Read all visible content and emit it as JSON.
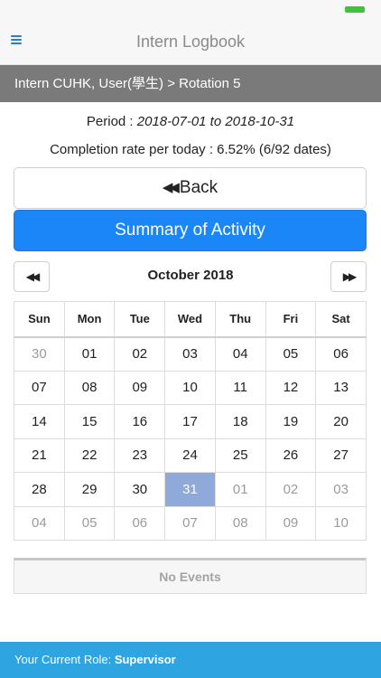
{
  "header": {
    "title": "Intern Logbook"
  },
  "breadcrumb": {
    "text": "Intern CUHK, User(學生) > Rotation 5"
  },
  "period": {
    "label": "Period : ",
    "value": "2018-07-01 to 2018-10-31"
  },
  "completion": {
    "text": "Completion rate per today : 6.52% (6/92 dates)"
  },
  "buttons": {
    "back": "Back",
    "summary": "Summary of Activity"
  },
  "calendar": {
    "month": "October 2018",
    "weekdays": [
      "Sun",
      "Mon",
      "Tue",
      "Wed",
      "Thu",
      "Fri",
      "Sat"
    ],
    "weeks": [
      [
        {
          "d": "30",
          "m": true
        },
        {
          "d": "01"
        },
        {
          "d": "02"
        },
        {
          "d": "03"
        },
        {
          "d": "04"
        },
        {
          "d": "05"
        },
        {
          "d": "06"
        }
      ],
      [
        {
          "d": "07"
        },
        {
          "d": "08"
        },
        {
          "d": "09"
        },
        {
          "d": "10"
        },
        {
          "d": "11"
        },
        {
          "d": "12"
        },
        {
          "d": "13"
        }
      ],
      [
        {
          "d": "14"
        },
        {
          "d": "15"
        },
        {
          "d": "16"
        },
        {
          "d": "17"
        },
        {
          "d": "18"
        },
        {
          "d": "19"
        },
        {
          "d": "20"
        }
      ],
      [
        {
          "d": "21"
        },
        {
          "d": "22"
        },
        {
          "d": "23"
        },
        {
          "d": "24"
        },
        {
          "d": "25"
        },
        {
          "d": "26"
        },
        {
          "d": "27"
        }
      ],
      [
        {
          "d": "28"
        },
        {
          "d": "29"
        },
        {
          "d": "30"
        },
        {
          "d": "31",
          "today": true
        },
        {
          "d": "01",
          "m": true
        },
        {
          "d": "02",
          "m": true
        },
        {
          "d": "03",
          "m": true
        }
      ],
      [
        {
          "d": "04",
          "m": true
        },
        {
          "d": "05",
          "m": true
        },
        {
          "d": "06",
          "m": true
        },
        {
          "d": "07",
          "m": true
        },
        {
          "d": "08",
          "m": true
        },
        {
          "d": "09",
          "m": true
        },
        {
          "d": "10",
          "m": true
        }
      ]
    ]
  },
  "events": {
    "empty_text": "No Events"
  },
  "footer": {
    "role_label": "Your Current Role: ",
    "role_value": "Supervisor"
  },
  "colors": {
    "primary": "#1a86f7",
    "today": "#8fa9d9",
    "footer": "#2ea4e0",
    "breadcrumb": "#7a7a7a"
  },
  "icons": {
    "menu": "hamburger-menu-icon",
    "back": "double-chevron-left-icon",
    "prev": "double-chevron-left-icon",
    "next": "double-chevron-right-icon"
  }
}
